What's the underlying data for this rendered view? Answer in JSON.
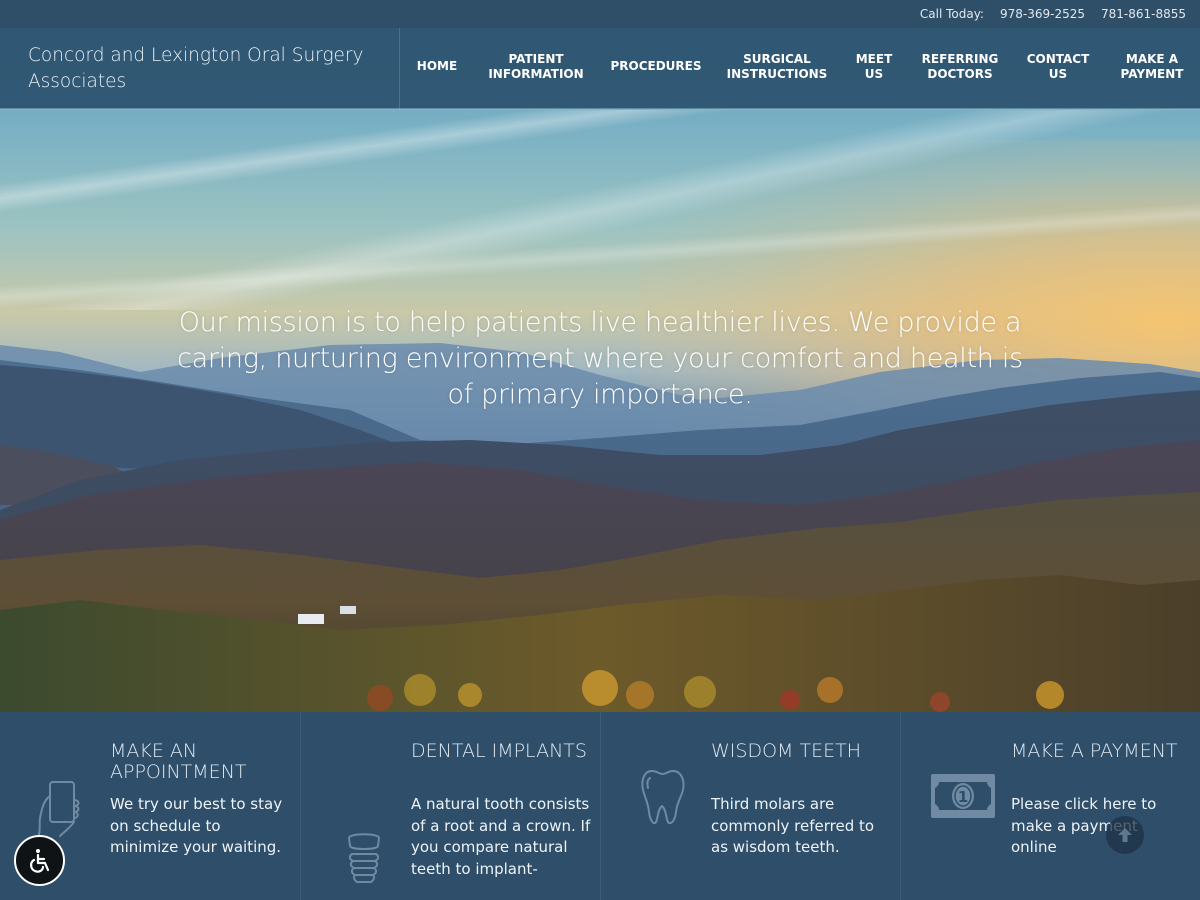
{
  "topbar": {
    "call_label": "Call Today:",
    "phones": [
      "978-369-2525",
      "781-861-8855"
    ]
  },
  "header": {
    "logo_text": "Concord and Lexington Oral Surgery Associates",
    "nav": [
      {
        "label": "HOME"
      },
      {
        "label": "PATIENT\nINFORMATION"
      },
      {
        "label": "PROCEDURES"
      },
      {
        "label": "SURGICAL\nINSTRUCTIONS"
      },
      {
        "label": "MEET\nUS"
      },
      {
        "label": "REFERRING\nDOCTORS"
      },
      {
        "label": "CONTACT\nUS"
      },
      {
        "label": "MAKE A\nPAYMENT"
      }
    ]
  },
  "hero": {
    "mission": "Our mission is to help patients live healthier lives. We provide a caring, nurturing environment where your comfort and health is of primary importance.",
    "image": "mountain-landscape-at-sunset"
  },
  "features": [
    {
      "title": "MAKE AN APPOINTMENT",
      "text": "We try our best to stay on schedule to minimize your waiting.",
      "icon": "phone-in-hand-icon"
    },
    {
      "title": "DENTAL IMPLANTS",
      "text": "A natural tooth consists of a root and a crown. If you compare natural teeth to implant-",
      "icon": "dental-implant-icon"
    },
    {
      "title": "WISDOM TEETH",
      "text": "Third molars are commonly referred to as wisdom teeth.",
      "icon": "tooth-icon"
    },
    {
      "title": "MAKE A PAYMENT",
      "text": "Please click here to make a payment online",
      "icon": "dollar-bill-icon"
    }
  ],
  "widgets": {
    "accessibility_icon": "wheelchair-icon",
    "scroll_top_icon": "arrow-up-icon"
  },
  "colors": {
    "header_bg": "#2c526e",
    "topbar_bg": "#2f4f68",
    "feature_bg": "#2e4e6a",
    "text_light": "#dfe9f1"
  }
}
